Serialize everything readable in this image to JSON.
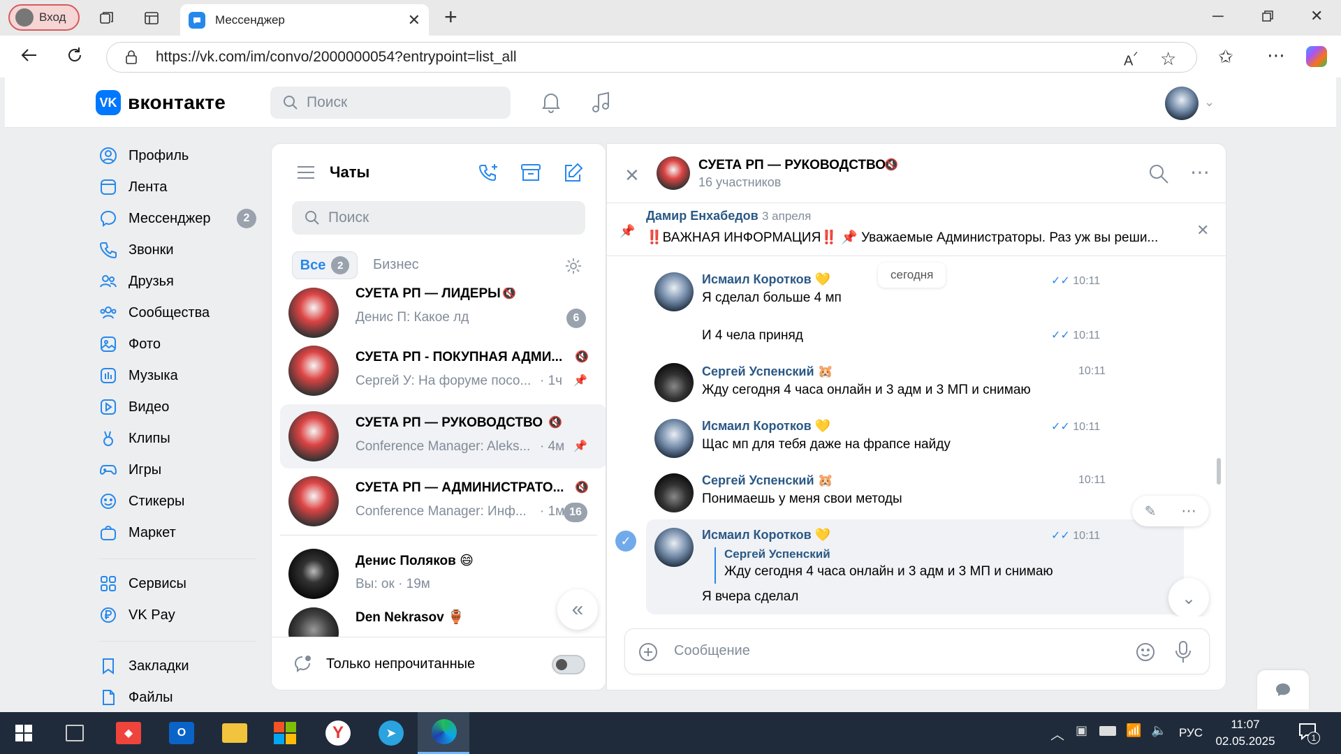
{
  "browser": {
    "profile_label": "Вход",
    "tab_title": "Мессенджер",
    "url": "https://vk.com/im/convo/2000000054?entrypoint=list_all"
  },
  "vk": {
    "logo": "вконтакте",
    "search_placeholder": "Поиск"
  },
  "sidebar": {
    "items": [
      {
        "label": "Профиль",
        "icon": "profile-icon"
      },
      {
        "label": "Лента",
        "icon": "feed-icon"
      },
      {
        "label": "Мессенджер",
        "icon": "messenger-icon",
        "badge": "2"
      },
      {
        "label": "Звонки",
        "icon": "phone-icon"
      },
      {
        "label": "Друзья",
        "icon": "friends-icon"
      },
      {
        "label": "Сообщества",
        "icon": "communities-icon"
      },
      {
        "label": "Фото",
        "icon": "photo-icon"
      },
      {
        "label": "Музыка",
        "icon": "music-icon"
      },
      {
        "label": "Видео",
        "icon": "video-icon"
      },
      {
        "label": "Клипы",
        "icon": "clips-icon"
      },
      {
        "label": "Игры",
        "icon": "games-icon"
      },
      {
        "label": "Стикеры",
        "icon": "stickers-icon"
      },
      {
        "label": "Маркет",
        "icon": "market-icon"
      },
      {
        "label": "Сервисы",
        "icon": "services-icon"
      },
      {
        "label": "VK Pay",
        "icon": "vkpay-icon"
      },
      {
        "label": "Закладки",
        "icon": "bookmarks-icon"
      },
      {
        "label": "Файлы",
        "icon": "files-icon"
      }
    ]
  },
  "chats": {
    "title": "Чаты",
    "search_placeholder": "Поиск",
    "filters": {
      "all": "Все",
      "all_count": "2",
      "business": "Бизнес"
    },
    "list": [
      {
        "title": "СУЕТА РП — ЛИДЕРЫ",
        "sub": "Денис П: Какое лд",
        "meta": "",
        "badge": "6"
      },
      {
        "title": "СУЕТА РП - ПОКУПНАЯ АДМИ...",
        "sub": "Сергей У: На форуме посо...",
        "meta": "· 1ч",
        "badge": ""
      },
      {
        "title": "СУЕТА РП — РУКОВОДСТВО",
        "sub": "Conference Manager: Aleks...",
        "meta": "· 4м",
        "badge": ""
      },
      {
        "title": "СУЕТА РП — АДМИНИСТРАТО...",
        "sub": "Conference Manager: Инф...",
        "meta": "· 1м",
        "badge": "16"
      },
      {
        "title": "Денис Поляков 😄",
        "sub": "Вы: ок",
        "meta": "· 19м",
        "badge": ""
      },
      {
        "title": "Den Nekrasov 🏺",
        "sub": "",
        "meta": "",
        "badge": ""
      }
    ],
    "unread_only": "Только непрочитанные"
  },
  "conversation": {
    "title": "СУЕТА РП — РУКОВОДСТВО",
    "members": "16 участников",
    "pinned_author": "Дамир Енхабедов",
    "pinned_date": "3 апреля",
    "pinned_text": "‼️ВАЖНАЯ ИНФОРМАЦИЯ‼️ 📌 Уважаемые Администраторы. Раз уж вы реши...",
    "date_chip": "сегодня",
    "messages": [
      {
        "name": "Исмаил Коротков 💛",
        "text": "Я сделал больше 4 мп",
        "time": "10:11"
      },
      {
        "name": "",
        "text": "И 4 чела приняд",
        "time": "10:11"
      },
      {
        "name": "Сергей Успенский 🐹",
        "text": "Жду сегодня 4 часа онлайн и 3 адм и 3 МП и снимаю",
        "time": "10:11"
      },
      {
        "name": "Исмаил Коротков 💛",
        "text": "Щас мп для тебя даже на фрапсе найду",
        "time": "10:11"
      },
      {
        "name": "Сергей Успенский 🐹",
        "text": "Понимаешь у меня свои методы",
        "time": "10:11"
      },
      {
        "name": "Исмаил Коротков 💛",
        "reply_name": "Сергей Успенский",
        "reply_text": "Жду сегодня 4 часа онлайн и 3 адм и 3 МП и снимаю",
        "text": "Я вчера сделал",
        "time": "10:11"
      }
    ],
    "composer_placeholder": "Сообщение"
  },
  "taskbar": {
    "lang": "РУС",
    "time": "11:07",
    "date": "02.05.2025",
    "notif_count": "1"
  }
}
